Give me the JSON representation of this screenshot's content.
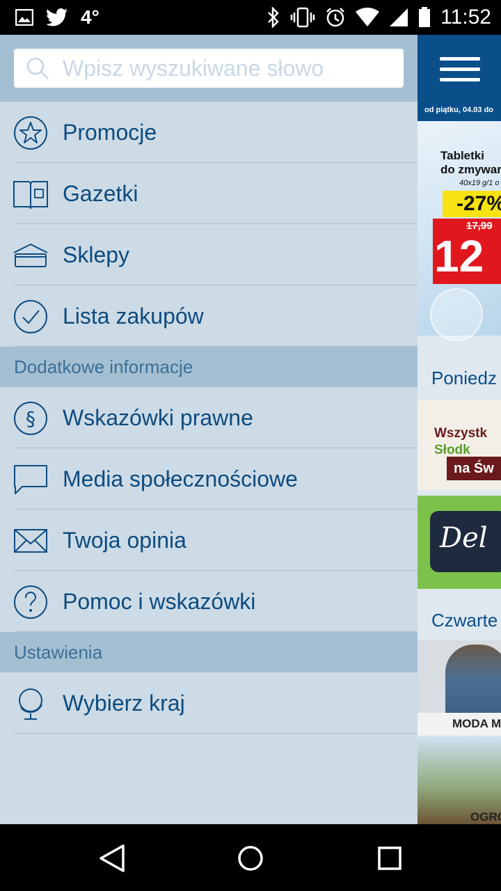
{
  "status_bar": {
    "temperature": "4°",
    "time": "11:52",
    "icons": [
      "image-icon",
      "twitter-icon",
      "bluetooth-icon",
      "vibrate-icon",
      "alarm-icon",
      "wifi-icon",
      "signal-icon",
      "battery-icon"
    ]
  },
  "search": {
    "placeholder": "Wpisz wyszukiwane słowo"
  },
  "menu": {
    "items": [
      {
        "label": "Promocje",
        "icon": "star-icon"
      },
      {
        "label": "Gazetki",
        "icon": "leaflet-icon"
      },
      {
        "label": "Sklepy",
        "icon": "store-icon"
      },
      {
        "label": "Lista zakupów",
        "icon": "check-icon"
      }
    ],
    "section_info": "Dodatkowe informacje",
    "info_items": [
      {
        "label": "Wskazówki prawne",
        "icon": "paragraph-icon"
      },
      {
        "label": "Media społecznościowe",
        "icon": "chat-bubble-icon"
      },
      {
        "label": "Twoja opinia",
        "icon": "envelope-icon"
      },
      {
        "label": "Pomoc i wskazówki",
        "icon": "help-icon"
      }
    ],
    "section_settings": "Ustawienia",
    "settings_items": [
      {
        "label": "Wybierz kraj",
        "icon": "globe-icon"
      }
    ]
  },
  "background": {
    "date_text": "od piątku, 04.03 do",
    "promo_title_1": "Tabletki",
    "promo_title_2": "do zmywar",
    "promo_size": "40x19 g/1 o",
    "promo_discount": "-27%",
    "promo_old_price": "17,99",
    "promo_new_price": "12",
    "section_monday": "Poniedz",
    "tile1_line1": "Wszystk",
    "tile1_line2": "Słodk",
    "tile1_box": "na Św",
    "tile2_text": "Del",
    "section_thursday": "Czwarte",
    "tile3_label": "MODA M",
    "tile4_label": "OGRO"
  },
  "colors": {
    "drawer_bg": "#cddbe6",
    "section_bg": "#a4bfd2",
    "label_blue": "#0d4b7f",
    "appbar_blue": "#0b4f8a"
  }
}
